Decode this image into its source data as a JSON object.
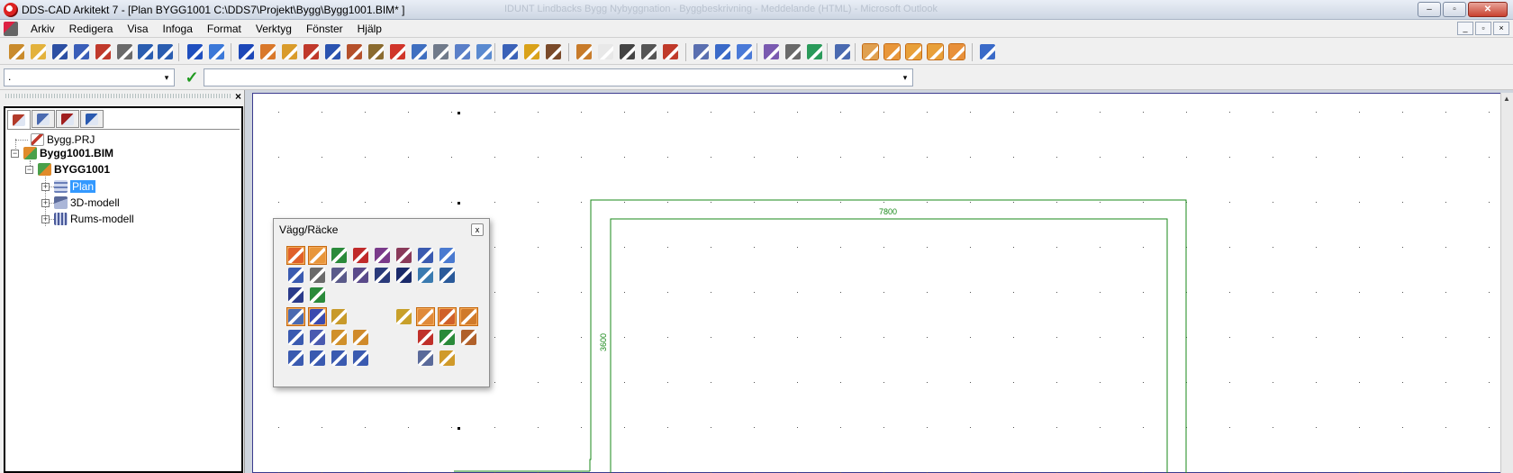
{
  "window": {
    "title": "DDS-CAD Arkitekt 7 - [Plan  BYGG1001  C:\\DDS7\\Projekt\\Bygg\\Bygg1001.BIM* ]",
    "background_title": "IDUNT Lindbacks Bygg Nybyggnation - Byggbeskrivning - Meddelande (HTML) - Microsoft Outlook",
    "minimize_label": "–",
    "maximize_label": "▫",
    "close_label": "✕"
  },
  "menu": {
    "items": [
      "Arkiv",
      "Redigera",
      "Visa",
      "Infoga",
      "Format",
      "Verktyg",
      "Fönster",
      "Hjälp"
    ],
    "mdi_minimize": "_",
    "mdi_restore": "▫",
    "mdi_close": "×"
  },
  "toolbar": {
    "icons": [
      {
        "name": "new-project-icon",
        "color": "#c98b2c"
      },
      {
        "name": "open-icon",
        "color": "#e3b23c"
      },
      {
        "name": "save-icon",
        "color": "#2c4fa3"
      },
      {
        "name": "save-all-icon",
        "color": "#3a5eb8"
      },
      {
        "name": "export-icon",
        "color": "#c0392b"
      },
      {
        "name": "print-icon",
        "color": "#6a6a6a"
      },
      {
        "name": "undo-icon",
        "color": "#2a5db0"
      },
      {
        "name": "redo-icon",
        "color": "#2a5db0"
      },
      {
        "name": "globe-icon",
        "color": "#1f4fbf"
      },
      {
        "name": "home-view-icon",
        "color": "#3b78d8"
      },
      {
        "name": "help-icon",
        "color": "#1c47b8"
      },
      {
        "name": "wall-icon",
        "color": "#d9782a"
      },
      {
        "name": "column-icon",
        "color": "#d99b2a"
      },
      {
        "name": "beam-icon",
        "color": "#c0392b"
      },
      {
        "name": "window-icon",
        "color": "#2a53b0"
      },
      {
        "name": "roof-icon",
        "color": "#b5502a"
      },
      {
        "name": "stair-icon",
        "color": "#8a6b2f"
      },
      {
        "name": "object-icon",
        "color": "#d0352a"
      },
      {
        "name": "room-icon",
        "color": "#3f6fc0"
      },
      {
        "name": "slab-icon",
        "color": "#707a8a"
      },
      {
        "name": "terrain-icon",
        "color": "#5a7fc8"
      },
      {
        "name": "furniture-icon",
        "color": "#5a8ad0"
      },
      {
        "name": "layers-icon",
        "color": "#3b62b8"
      },
      {
        "name": "stop-icon",
        "color": "#d9a21a"
      },
      {
        "name": "tools-icon",
        "color": "#7a4a2a"
      },
      {
        "name": "pencil-icon",
        "color": "#c87b2a"
      },
      {
        "name": "blank-icon",
        "color": "#e8e8e8"
      },
      {
        "name": "eye-icon",
        "color": "#444444"
      },
      {
        "name": "sun-icon",
        "color": "#555555"
      },
      {
        "name": "search-zoom-icon",
        "color": "#c03a2a"
      },
      {
        "name": "grid-active-icon",
        "color": "#5a6fb0"
      },
      {
        "name": "house-icon",
        "color": "#3a6ac8"
      },
      {
        "name": "house-3d-icon",
        "color": "#4a7ad8"
      },
      {
        "name": "dimension-icon",
        "color": "#7a5ab0"
      },
      {
        "name": "camera-icon",
        "color": "#6a6a6a"
      },
      {
        "name": "copy-icon",
        "color": "#2a9a5a"
      },
      {
        "name": "text-icon",
        "color": "#4a6ab0"
      },
      {
        "name": "snap-grid-icon",
        "color": "#e0a050"
      },
      {
        "name": "snap-point-icon",
        "color": "#e8963a"
      },
      {
        "name": "snap-dots-icon",
        "color": "#e8a03a"
      },
      {
        "name": "snap-angle-icon",
        "color": "#e8a03a"
      },
      {
        "name": "snap-wall-icon",
        "color": "#e8903a"
      },
      {
        "name": "settings-icon",
        "color": "#3a6ac8"
      }
    ]
  },
  "input_bar": {
    "command_value": ".",
    "command_arrow": "▾",
    "confirm_icon_label": "✓",
    "prompt_value": "",
    "prompt_arrow": "▾"
  },
  "left_panel": {
    "close_label": "×",
    "tabs": [
      {
        "name": "tab-project-tree",
        "color": "#b23a2a"
      },
      {
        "name": "tab-catalog",
        "color": "#4a6ab0"
      },
      {
        "name": "tab-layers",
        "color": "#a02020"
      },
      {
        "name": "tab-symbols",
        "color": "#2a5ab0"
      }
    ],
    "tree": {
      "project": "Bygg.PRJ",
      "bim": "Bygg1001.BIM",
      "building": "BYGG1001",
      "children": [
        "Plan",
        "3D-modell",
        "Rums-modell"
      ],
      "selected": "Plan",
      "expand_label": "+",
      "collapse_label": "−"
    }
  },
  "palette": {
    "title": "Vägg/Räcke",
    "close_label": "x",
    "buttons": [
      {
        "name": "wall-point-icon",
        "color": "#e0602a",
        "on": true
      },
      {
        "name": "wall-grid-icon",
        "color": "#e8963a",
        "on": true
      },
      {
        "name": "wall-align-icon",
        "color": "#2a8a3a",
        "on": false
      },
      {
        "name": "wall-offset-icon",
        "color": "#c02a2a",
        "on": false
      },
      {
        "name": "wall-type-a-icon",
        "color": "#7a3a8a",
        "on": false
      },
      {
        "name": "wall-type-b-icon",
        "color": "#8a3a5a",
        "on": false
      },
      {
        "name": "wall-type-c-icon",
        "color": "#3a5ab0",
        "on": false
      },
      {
        "name": "wall-type-d-icon",
        "color": "#4a7ad0",
        "on": false
      },
      {
        "name": "wall-corner-icon",
        "color": "#3a5ab0",
        "on": false
      },
      {
        "name": "polygon-icon",
        "color": "#6a6a6a",
        "on": false
      },
      {
        "name": "spline-icon",
        "color": "#5a5a8a",
        "on": false
      },
      {
        "name": "arc-wall-icon",
        "color": "#5a4a8a",
        "on": false
      },
      {
        "name": "dashed-line-icon",
        "color": "#2a3a7a",
        "on": false
      },
      {
        "name": "double-line-icon",
        "color": "#1a2a6a",
        "on": false
      },
      {
        "name": "fill-wall-icon",
        "color": "#3a7ab0",
        "on": false
      },
      {
        "name": "cross-wall-icon",
        "color": "#2a5a9a",
        "on": false
      },
      {
        "name": "railing-icon",
        "color": "#2a3a8a",
        "on": false
      },
      {
        "name": "railing-end-icon",
        "color": "#2a8a3a",
        "on": false
      },
      {
        "name": "join-walls-icon",
        "color": "#4a6ab0",
        "on": true
      },
      {
        "name": "wall-properties-icon",
        "color": "#3a4ab0",
        "on": true
      },
      {
        "name": "wall-copy-icon",
        "color": "#c89a2a",
        "on": false
      },
      {
        "name": "wall-mirror-icon",
        "color": "#c8a02a",
        "on": false
      },
      {
        "name": "wall-extend-icon",
        "color": "#e08a3a",
        "on": true
      },
      {
        "name": "wall-trim-icon",
        "color": "#d0602a",
        "on": true
      },
      {
        "name": "wall-split-icon",
        "color": "#d07a2a",
        "on": true
      },
      {
        "name": "wall-layer-icon",
        "color": "#3a5ab0",
        "on": false
      },
      {
        "name": "wall-edit-icon",
        "color": "#4a5ab0",
        "on": false
      },
      {
        "name": "wall-cross-icon",
        "color": "#d0902a",
        "on": false
      },
      {
        "name": "wall-columns-icon",
        "color": "#d08a2a",
        "on": false
      },
      {
        "name": "wall-connect-icon",
        "color": "#c0302a",
        "on": false
      },
      {
        "name": "wall-stack-icon",
        "color": "#2a8a3a",
        "on": false
      },
      {
        "name": "wall-board-icon",
        "color": "#b0602a",
        "on": false
      },
      {
        "name": "wall-query-icon",
        "color": "#3a5ab0",
        "on": false
      },
      {
        "name": "wall-query-2-icon",
        "color": "#3a5ab0",
        "on": false
      },
      {
        "name": "wall-query-3-icon",
        "color": "#3a5ab0",
        "on": false
      },
      {
        "name": "wall-query-4-icon",
        "color": "#3a5ab0",
        "on": false
      },
      {
        "name": "wall-finish-icon",
        "color": "#5a6a9a",
        "on": false
      },
      {
        "name": "wall-texture-icon",
        "color": "#d09a2a",
        "on": false
      }
    ]
  },
  "drawing": {
    "dimension_horizontal": "7800",
    "dimension_vertical": "3600",
    "line_color": "#1a8a1a",
    "border_color": "#3b3b8e"
  }
}
